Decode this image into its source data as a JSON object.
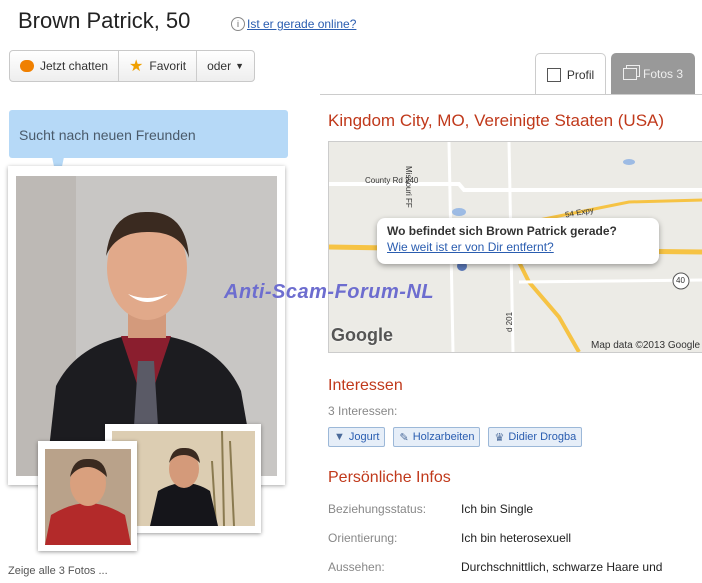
{
  "profile": {
    "name_age": "Brown Patrick, 50",
    "online_icon_glyph": "i",
    "online_link": "Ist er gerade online?",
    "status_bubble": "Sucht nach neuen Freunden",
    "show_all_photos": "Zeige alle 3 Fotos ..."
  },
  "actions": {
    "chat": "Jetzt chatten",
    "favorite": "Favorit",
    "more": "oder"
  },
  "tabs": [
    {
      "label": "Profil",
      "icon": "profile-icon",
      "active": true
    },
    {
      "label": "Fotos 3",
      "icon": "photos-icon",
      "active": false
    }
  ],
  "location": "Kingdom City, MO, Vereinigte Staaten (USA)",
  "map": {
    "labels": [
      "County Rd 240",
      "Missouri FF",
      "54 Expy",
      "40",
      "d 201",
      "d 201"
    ],
    "popup_question": "Wo befindet sich Brown Patrick gerade?",
    "popup_link": "Wie weit ist er von Dir entfernt?",
    "logo": "Google",
    "attribution": "Map data ©2013 Google"
  },
  "watermark": "Anti-Scam-Forum-NL",
  "interests": {
    "heading": "Interessen",
    "count": "3 Interessen:",
    "items": [
      {
        "label": "Jogurt",
        "icon": "food-icon"
      },
      {
        "label": "Holzarbeiten",
        "icon": "tools-icon"
      },
      {
        "label": "Didier Drogba",
        "icon": "trophy-icon"
      }
    ]
  },
  "personal": {
    "heading": "Persönliche Infos",
    "rows": [
      {
        "key": "Beziehungsstatus:",
        "value": "Ich bin Single"
      },
      {
        "key": "Orientierung:",
        "value": "Ich bin heterosexuell"
      },
      {
        "key": "Aussehen:",
        "value": "Durchschnittlich, schwarze Haare und"
      }
    ]
  },
  "colors": {
    "accent_red": "#c0391b",
    "link_blue": "#2a5db0",
    "bubble_blue": "#b6d9f7",
    "watermark_blue": "#6d6dcf"
  }
}
